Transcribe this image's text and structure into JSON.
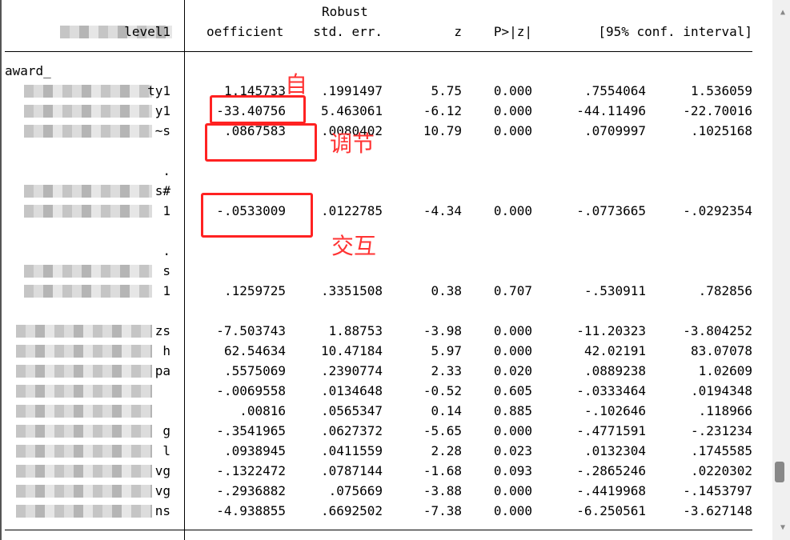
{
  "header": {
    "robust": "Robust",
    "col0": "level1",
    "cols": [
      "oefficient",
      "std. err.",
      "z",
      "P>|z|",
      "[95% conf. interval]"
    ]
  },
  "rows": [
    {
      "label": "award_",
      "coef": "",
      "se": "",
      "z": "",
      "p": "",
      "lo": "",
      "hi": ""
    },
    {
      "label": "ty1",
      "coef": "1.145733",
      "se": ".1991497",
      "z": "5.75",
      "p": "0.000",
      "lo": ".7554064",
      "hi": "1.536059"
    },
    {
      "label": "y1",
      "coef": "-33.40756",
      "se": "5.463061",
      "z": "-6.12",
      "p": "0.000",
      "lo": "-44.11496",
      "hi": "-22.70016"
    },
    {
      "label": "~s",
      "coef": ".0867583",
      "se": ".0080402",
      "z": "10.79",
      "p": "0.000",
      "lo": ".0709997",
      "hi": ".1025168"
    },
    {
      "label": ".",
      "coef": "",
      "se": "",
      "z": "",
      "p": "",
      "lo": "",
      "hi": ""
    },
    {
      "label": "s#",
      "coef": "",
      "se": "",
      "z": "",
      "p": "",
      "lo": "",
      "hi": ""
    },
    {
      "label": "1",
      "coef": "-.0533009",
      "se": ".0122785",
      "z": "-4.34",
      "p": "0.000",
      "lo": "-.0773665",
      "hi": "-.0292354"
    },
    {
      "label": ".",
      "coef": "",
      "se": "",
      "z": "",
      "p": "",
      "lo": "",
      "hi": ""
    },
    {
      "label": "s",
      "coef": "",
      "se": "",
      "z": "",
      "p": "",
      "lo": "",
      "hi": ""
    },
    {
      "label": "1",
      "coef": ".1259725",
      "se": ".3351508",
      "z": "0.38",
      "p": "0.707",
      "lo": "-.530911",
      "hi": ".782856"
    },
    {
      "label": "zs",
      "coef": "-7.503743",
      "se": "1.88753",
      "z": "-3.98",
      "p": "0.000",
      "lo": "-11.20323",
      "hi": "-3.804252"
    },
    {
      "label": "h",
      "coef": "62.54634",
      "se": "10.47184",
      "z": "5.97",
      "p": "0.000",
      "lo": "42.02191",
      "hi": "83.07078"
    },
    {
      "label": "pa",
      "coef": ".5575069",
      "se": ".2390774",
      "z": "2.33",
      "p": "0.020",
      "lo": ".0889238",
      "hi": "1.02609"
    },
    {
      "label": "",
      "coef": "-.0069558",
      "se": ".0134648",
      "z": "-0.52",
      "p": "0.605",
      "lo": "-.0333464",
      "hi": ".0194348"
    },
    {
      "label": "",
      "coef": ".00816",
      "se": ".0565347",
      "z": "0.14",
      "p": "0.885",
      "lo": "-.102646",
      "hi": ".118966"
    },
    {
      "label": "g",
      "coef": "-.3541965",
      "se": ".0627372",
      "z": "-5.65",
      "p": "0.000",
      "lo": "-.4771591",
      "hi": "-.231234"
    },
    {
      "label": "l",
      "coef": ".0938945",
      "se": ".0411559",
      "z": "2.28",
      "p": "0.023",
      "lo": ".0132304",
      "hi": ".1745585"
    },
    {
      "label": "vg",
      "coef": "-.1322472",
      "se": ".0787144",
      "z": "-1.68",
      "p": "0.093",
      "lo": "-.2865246",
      "hi": ".0220302"
    },
    {
      "label": "vg",
      "coef": "-.2936882",
      "se": ".075669",
      "z": "-3.88",
      "p": "0.000",
      "lo": "-.4419968",
      "hi": "-.1453797"
    },
    {
      "label": "ns",
      "coef": "-4.938855",
      "se": ".6692502",
      "z": "-7.38",
      "p": "0.000",
      "lo": "-6.250561",
      "hi": "-3.627148"
    }
  ],
  "annotations": {
    "a1": "自",
    "a2": "调节",
    "a3": "交互"
  },
  "colors": {
    "annotation": "#ff2222"
  }
}
